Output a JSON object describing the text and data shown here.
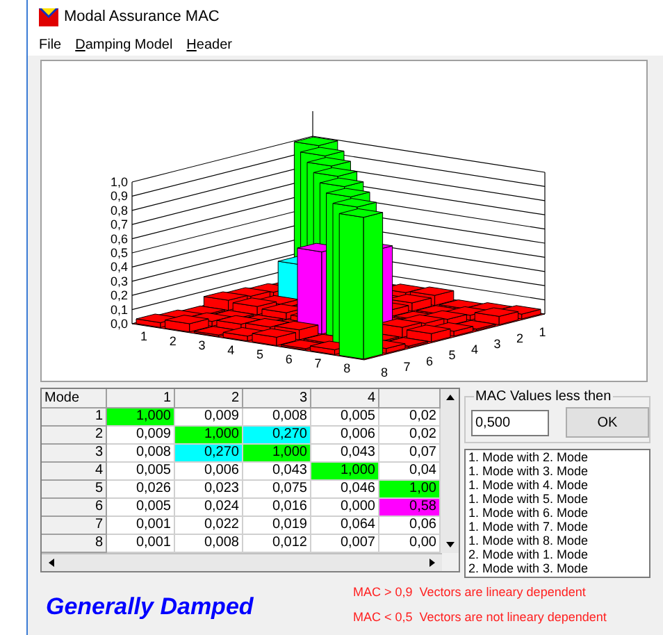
{
  "window": {
    "title": "Modal Assurance  MAC"
  },
  "menu": [
    {
      "label": "File",
      "underlined": false
    },
    {
      "label": "Damping Model",
      "underlined": true
    },
    {
      "label": "Header",
      "underlined": true
    }
  ],
  "chart": {
    "z_ticks": [
      "1,0",
      "0,9",
      "0,8",
      "0,7",
      "0,6",
      "0,5",
      "0,4",
      "0,3",
      "0,2",
      "0,1",
      "0,0"
    ],
    "x_ticks": [
      "1",
      "2",
      "3",
      "4",
      "5",
      "6",
      "7",
      "8"
    ],
    "y_ticks": [
      "8",
      "7",
      "6",
      "5",
      "4",
      "3",
      "2",
      "1"
    ]
  },
  "table": {
    "columns": [
      "Mode",
      "1",
      "2",
      "3",
      "4"
    ],
    "rows": [
      {
        "cells": [
          {
            "text": "1"
          },
          {
            "text": "1,000",
            "color": "#00ff00"
          },
          {
            "text": "0,009"
          },
          {
            "text": "0,008"
          },
          {
            "text": "0,005"
          },
          {
            "text": "0,02"
          }
        ]
      },
      {
        "cells": [
          {
            "text": "2"
          },
          {
            "text": "0,009"
          },
          {
            "text": "1,000",
            "color": "#00ff00"
          },
          {
            "text": "0,270",
            "color": "#00ffff"
          },
          {
            "text": "0,006"
          },
          {
            "text": "0,02"
          }
        ]
      },
      {
        "cells": [
          {
            "text": "3"
          },
          {
            "text": "0,008"
          },
          {
            "text": "0,270",
            "color": "#00ffff"
          },
          {
            "text": "1,000",
            "color": "#00ff00"
          },
          {
            "text": "0,043"
          },
          {
            "text": "0,07"
          }
        ]
      },
      {
        "cells": [
          {
            "text": "4"
          },
          {
            "text": "0,005"
          },
          {
            "text": "0,006"
          },
          {
            "text": "0,043"
          },
          {
            "text": "1,000",
            "color": "#00ff00"
          },
          {
            "text": "0,04"
          }
        ]
      },
      {
        "cells": [
          {
            "text": "5"
          },
          {
            "text": "0,026"
          },
          {
            "text": "0,023"
          },
          {
            "text": "0,075"
          },
          {
            "text": "0,046"
          },
          {
            "text": "1,00",
            "color": "#00ff00"
          }
        ]
      },
      {
        "cells": [
          {
            "text": "6"
          },
          {
            "text": "0,005"
          },
          {
            "text": "0,024"
          },
          {
            "text": "0,016"
          },
          {
            "text": "0,000"
          },
          {
            "text": "0,58",
            "color": "#ff00ff"
          }
        ]
      },
      {
        "cells": [
          {
            "text": "7"
          },
          {
            "text": "0,001"
          },
          {
            "text": "0,022"
          },
          {
            "text": "0,019"
          },
          {
            "text": "0,064"
          },
          {
            "text": "0,06"
          }
        ]
      },
      {
        "cells": [
          {
            "text": "8"
          },
          {
            "text": "0,001"
          },
          {
            "text": "0,008"
          },
          {
            "text": "0,012"
          },
          {
            "text": "0,007"
          },
          {
            "text": "0,00"
          }
        ]
      }
    ]
  },
  "threshold": {
    "label": "MAC Values less then",
    "value": "0,500",
    "button": "OK"
  },
  "pairs": [
    "1. Mode with 2. Mode",
    "1. Mode with 3. Mode",
    "1. Mode with 4. Mode",
    "1. Mode with 5. Mode",
    "1. Mode with 6. Mode",
    "1. Mode with 7. Mode",
    "1. Mode with 8. Mode",
    "2. Mode with 1. Mode",
    "2. Mode with 3. Mode"
  ],
  "damping": "Generally Damped",
  "legend": [
    "MAC > 0,9  Vectors are lineary dependent",
    "MAC < 0,5  Vectors are not lineary dependent"
  ]
}
